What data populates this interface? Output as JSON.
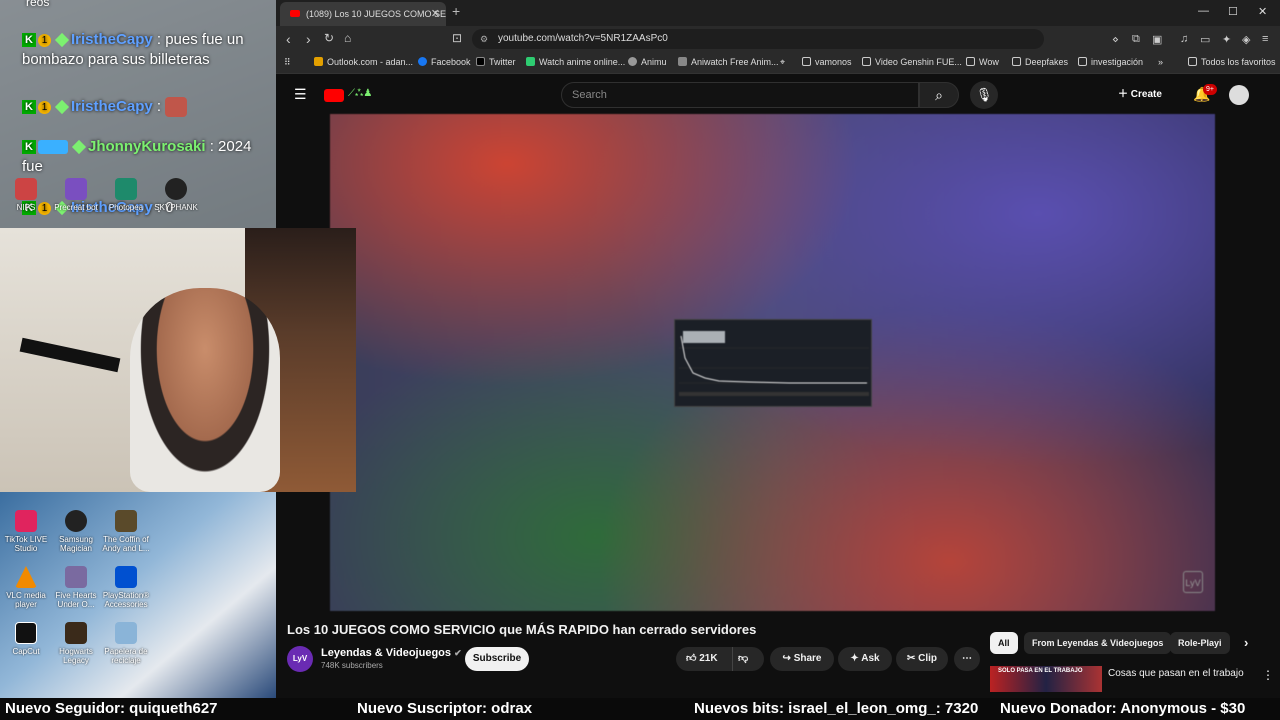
{
  "chat": {
    "messages": [
      {
        "user": "IristheCapy",
        "text": ": pues fue un bombazo para sus billeteras"
      },
      {
        "user": "IristheCapy",
        "text": ""
      },
      {
        "user": "JhonnyKurosaki",
        "text": ": 2024 fue"
      },
      {
        "user": "IristheCapy",
        "text": ": 0"
      }
    ],
    "top_fragment": "reos"
  },
  "desktop": {
    "icons": [
      "TikTok LIVE Studio",
      "Samsung Magician",
      "The Coffin of Andy and L...",
      "VLC media player",
      "Five Hearts Under O...",
      "PlayStation® Accessories",
      "CapCut",
      "Hogwarts Legacy",
      "Papelera de reciclaje"
    ],
    "overlay_icons": [
      "NIPS",
      "Precreat bot",
      "Photopea",
      "SKYPHANK"
    ]
  },
  "browser": {
    "tab_title": "(1089) Los 10 JUEGOS COMO SE",
    "url": "youtube.com/watch?v=5NR1ZAAsPc0",
    "bookmarks": [
      "Outlook.com - adan...",
      "Facebook",
      "Twitter",
      "Watch anime online...",
      "Animu",
      "Aniwatch Free Anim...",
      "vamonos",
      "Video Genshin FUE...",
      "Wow",
      "Deepfakes",
      "investigación",
      "Todos los favoritos"
    ]
  },
  "youtube": {
    "search_placeholder": "Search",
    "create_label": "Create",
    "notif_count": "9+",
    "video_title": "Los 10 JUEGOS COMO SERVICIO que MÁS RAPIDO han cerrado servidores",
    "channel_name": "Leyendas & Videojuegos",
    "channel_logo": "LyV",
    "subscribers": "748K subscribers",
    "subscribe_label": "Subscribe",
    "likes": "21K",
    "share_label": "Share",
    "ask_label": "Ask",
    "clip_label": "Clip",
    "chips": [
      "All",
      "From Leyendas & Videojuegos",
      "Role-Playi"
    ],
    "rec_title": "Cosas que pasan en el trabajo",
    "rec_thumb_text": "SOLO PASA EN EL TRABAJO"
  },
  "ticker": {
    "follower": "Nuevo Seguidor: quiqueth627",
    "subscriber": "Nuevo Suscriptor: odrax",
    "bits": "Nuevos bits: israel_el_leon_omg_: 7320",
    "donation": "Nuevo Donador: Anonymous - $30"
  }
}
